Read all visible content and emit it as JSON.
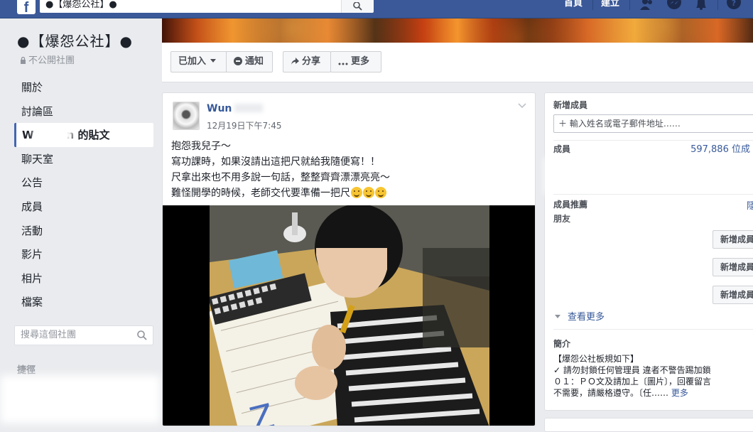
{
  "topbar": {
    "logo": "f",
    "search_value": "●【爆怨公社】●",
    "nav_home": "首頁",
    "nav_create": "建立",
    "icons": [
      "friends-icon",
      "messenger-icon",
      "notifications-icon",
      "help-icon"
    ]
  },
  "group": {
    "name": "●【爆怨公社】●",
    "privacy": "不公開社團",
    "nav": [
      {
        "label": "關於"
      },
      {
        "label": "討論區"
      },
      {
        "label_prefix": "W",
        "label_suffix": "n 的貼文"
      },
      {
        "label": "聊天室"
      },
      {
        "label": "公告"
      },
      {
        "label": "成員"
      },
      {
        "label": "活動"
      },
      {
        "label": "影片"
      },
      {
        "label": "相片"
      },
      {
        "label": "檔案"
      }
    ],
    "search_placeholder": "搜尋這個社團",
    "shortcuts": "捷徑"
  },
  "actions": {
    "joined": "已加入",
    "notify": "通知",
    "share": "分享",
    "more": "更多"
  },
  "post": {
    "author": "Wun",
    "timestamp": "12月19日下午7:45",
    "lines": [
      "抱怨我兒子～",
      "寫功課時，如果沒請出這把尺就給我隨便寫！！",
      "尺拿出來也不用多說一句話，整整齊齊漂漂亮亮～",
      "難怪開學的時候，老師交代要準備一把尺"
    ]
  },
  "sidebar": {
    "new_members_title": "新增成員",
    "add_placeholder": "＋ 輸入姓名或電子郵件地址……",
    "members_title": "成員",
    "members_count": "597,886 位成",
    "suggested_title": "成員推薦",
    "hide": "隱",
    "friends": "朋友",
    "add_label": "新增成員",
    "see_more": "查看更多",
    "intro_title": "簡介",
    "rules": [
      "【爆怨公社板規如下】",
      "✓ 請勿封鎖任何管理員 違者不警告踢加鎖",
      "０１：ＰＯ文及請加上〔圖片〕，回覆留言",
      "不需要，請嚴格遵守。〔任……"
    ],
    "rules_more": "更多"
  },
  "colors": {
    "brand": "#3b5998",
    "link": "#365899",
    "page_bg": "#e9ebee"
  }
}
